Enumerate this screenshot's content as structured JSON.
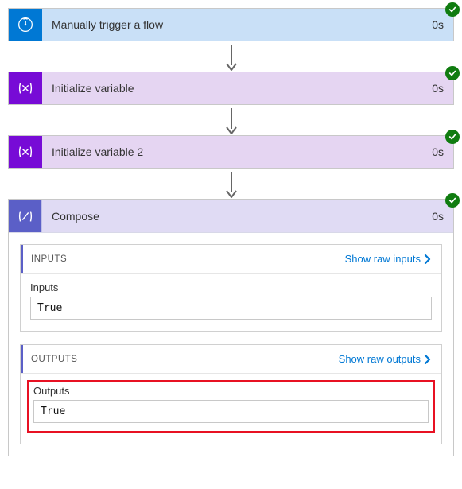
{
  "steps": {
    "trigger": {
      "title": "Manually trigger a flow",
      "duration": "0s"
    },
    "var1": {
      "title": "Initialize variable",
      "duration": "0s"
    },
    "var2": {
      "title": "Initialize variable 2",
      "duration": "0s"
    },
    "compose": {
      "title": "Compose",
      "duration": "0s"
    }
  },
  "compose_panel": {
    "inputs": {
      "section_label": "INPUTS",
      "raw_link": "Show raw inputs",
      "field_label": "Inputs",
      "value": "True"
    },
    "outputs": {
      "section_label": "OUTPUTS",
      "raw_link": "Show raw outputs",
      "field_label": "Outputs",
      "value": "True"
    }
  }
}
